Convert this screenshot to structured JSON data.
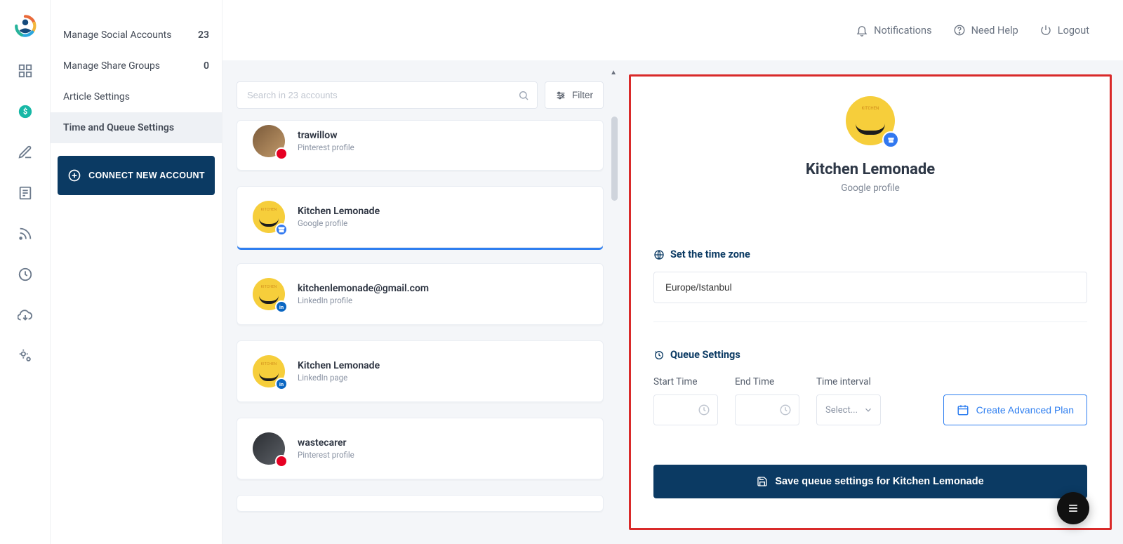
{
  "topbar": {
    "notifications": "Notifications",
    "help": "Need Help",
    "logout": "Logout"
  },
  "sidebar": {
    "items": [
      {
        "label": "Manage Social Accounts",
        "count": "23"
      },
      {
        "label": "Manage Share Groups",
        "count": "0"
      },
      {
        "label": "Article Settings",
        "count": ""
      },
      {
        "label": "Time and Queue Settings",
        "count": ""
      }
    ],
    "connect_btn": "CONNECT NEW ACCOUNT"
  },
  "accounts": {
    "search_placeholder": "Search in 23 accounts",
    "filter_label": "Filter",
    "list": [
      {
        "name": "trawillow",
        "sub": "Pinterest profile"
      },
      {
        "name": "Kitchen Lemonade",
        "sub": "Google profile"
      },
      {
        "name": "kitchenlemonade@gmail.com",
        "sub": "LinkedIn profile"
      },
      {
        "name": "Kitchen Lemonade",
        "sub": "LinkedIn page"
      },
      {
        "name": "wastecarer",
        "sub": "Pinterest profile"
      }
    ]
  },
  "details": {
    "name": "Kitchen Lemonade",
    "sub": "Google profile",
    "timezone_heading": "Set the time zone",
    "timezone_value": "Europe/Istanbul",
    "queue_heading": "Queue Settings",
    "start_label": "Start Time",
    "end_label": "End Time",
    "interval_label": "Time interval",
    "interval_placeholder": "Select...",
    "create_plan": "Create Advanced Plan",
    "save_btn": "Save queue settings for Kitchen Lemonade"
  }
}
